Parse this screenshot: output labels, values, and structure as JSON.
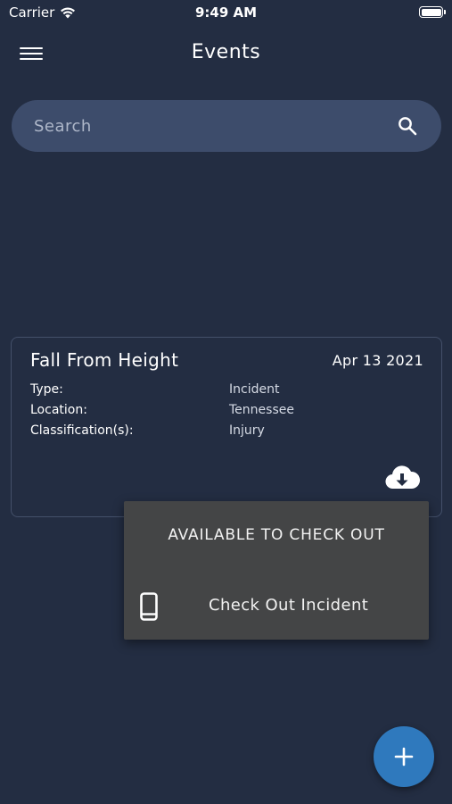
{
  "status_bar": {
    "carrier": "Carrier",
    "time": "9:49 AM",
    "wifi_icon": "wifi-icon",
    "battery_icon": "battery-full-icon"
  },
  "nav": {
    "title": "Events",
    "menu_icon": "hamburger-menu-icon"
  },
  "search": {
    "placeholder": "Search",
    "value": "",
    "icon": "search-icon"
  },
  "event_card": {
    "title": "Fall From Height",
    "date": "Apr 13 2021",
    "fields": [
      {
        "label": "Type:",
        "value": "Incident"
      },
      {
        "label": "Location:",
        "value": "Tennessee"
      },
      {
        "label": "Classification(s):",
        "value": "Injury"
      }
    ],
    "action_icon": "cloud-download-icon"
  },
  "popup_menu": {
    "header": "AVAILABLE TO CHECK OUT",
    "items": [
      {
        "label": "Check Out Incident",
        "icon": "phone-icon"
      }
    ]
  },
  "fab": {
    "icon": "plus-icon"
  },
  "colors": {
    "background": "#232d42",
    "search_bg": "#3d4c6b",
    "popup_bg": "#444546",
    "fab_bg": "#2f79bd"
  }
}
